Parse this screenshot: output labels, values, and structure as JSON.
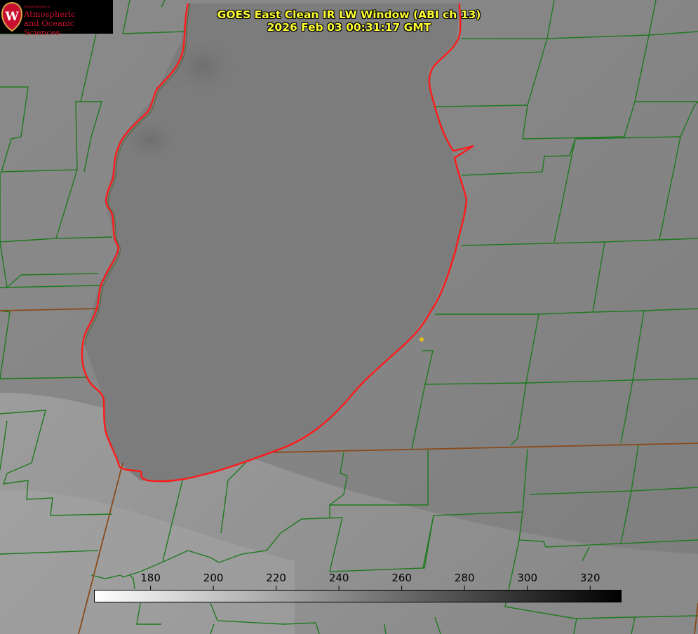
{
  "title": {
    "line1": "GOES East Clean IR LW Window (ABI ch 13)",
    "line2": "2026 Feb 03 00:31:17 GMT"
  },
  "logo": {
    "small": "Department of",
    "line1": "Atmospheric",
    "line2": "and Oceanic Sciences",
    "icon": "uw-crest-icon"
  },
  "colorbar": {
    "ticks": [
      "180",
      "200",
      "220",
      "240",
      "260",
      "280",
      "300",
      "320"
    ],
    "range_min": 162,
    "range_max": 330,
    "gradient": [
      "#ffffff",
      "#000000"
    ]
  },
  "colors": {
    "county_lines": "#1e7a1e",
    "lake_outline": "#ff1a1a",
    "state_lines": "#8a4a1a",
    "marker": "#e0c020"
  }
}
